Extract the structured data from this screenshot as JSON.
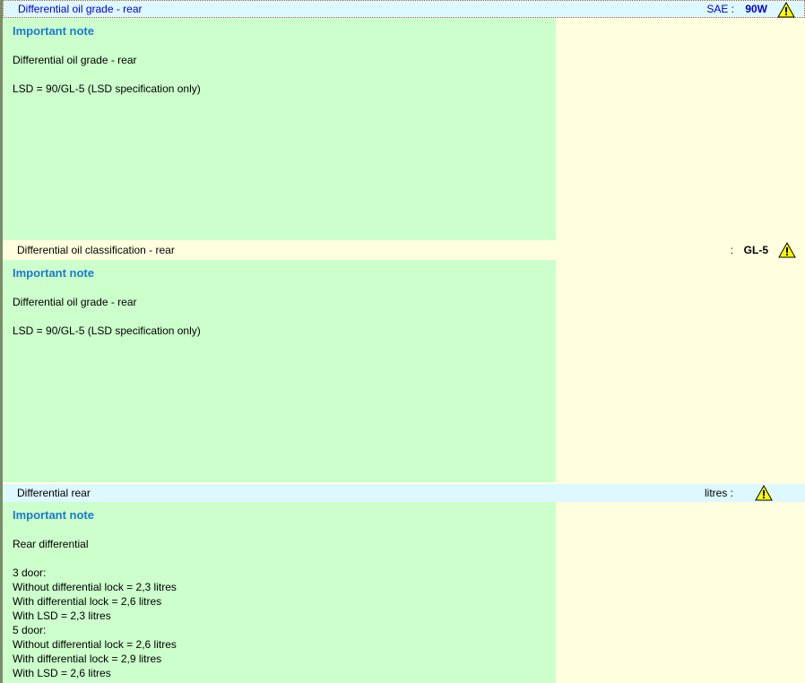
{
  "rows": [
    {
      "label": "Differential oil grade - rear",
      "unit": "SAE :",
      "value": "90W",
      "icon": "warning-icon"
    },
    {
      "label": "Differential oil classification - rear",
      "unit": ":",
      "value": "GL-5",
      "icon": "warning-icon"
    },
    {
      "label": "Differential rear",
      "unit": "litres :",
      "value": "",
      "icon": "warning-icon"
    }
  ],
  "notes": [
    {
      "title": "Important note",
      "paragraphs": [
        "Differential oil grade - rear",
        "LSD = 90/GL-5 (LSD specification only)"
      ]
    },
    {
      "title": "Important note",
      "paragraphs": [
        "Differential oil grade - rear",
        "LSD = 90/GL-5 (LSD specification only)"
      ]
    },
    {
      "title": "Important note",
      "paragraphs": [
        "Rear differential",
        "3 door:\nWithout differential lock = 2,3 litres\nWith differential lock = 2,6 litres\nWith LSD = 2,3 litres\n5 door:\nWithout differential lock = 2,6 litres\nWith differential lock = 2,9 litres\nWith LSD = 2,6 litres"
      ]
    }
  ]
}
